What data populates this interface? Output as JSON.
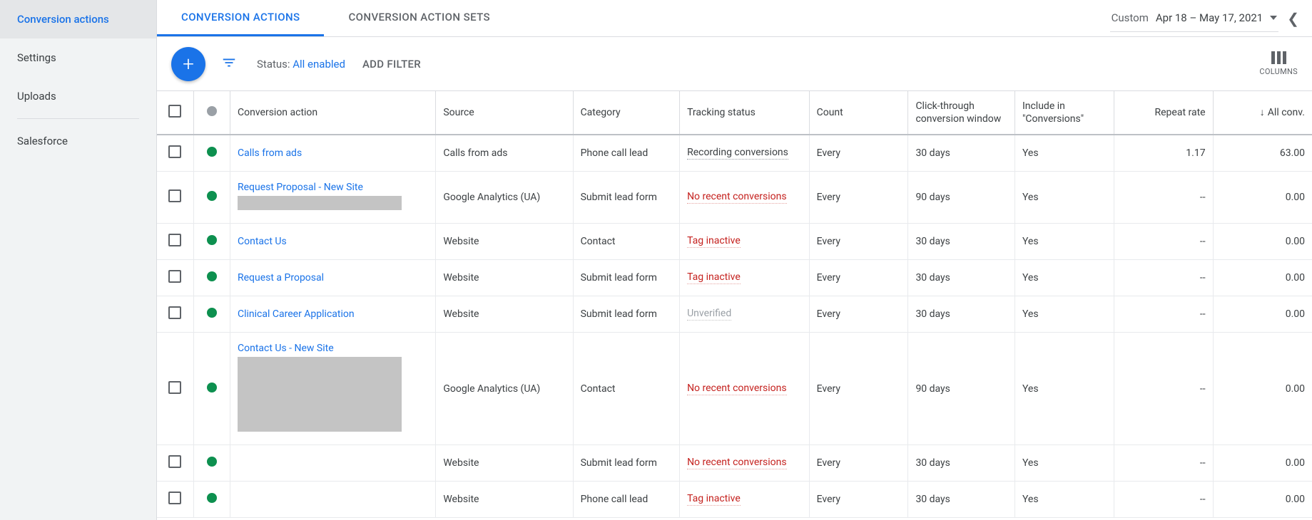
{
  "sidebar": {
    "items": [
      {
        "label": "Conversion actions",
        "active": true
      },
      {
        "label": "Settings",
        "active": false
      },
      {
        "label": "Uploads",
        "active": false
      },
      {
        "label": "Salesforce",
        "active": false
      }
    ]
  },
  "tabs": [
    {
      "label": "CONVERSION ACTIONS",
      "active": true
    },
    {
      "label": "CONVERSION ACTION SETS",
      "active": false
    }
  ],
  "datePicker": {
    "modeLabel": "Custom",
    "range": "Apr 18 – May 17, 2021"
  },
  "filterBar": {
    "statusPrefix": "Status: ",
    "statusValue": "All enabled",
    "addFilter": "ADD FILTER",
    "columnsLabel": "COLUMNS"
  },
  "table": {
    "headers": {
      "conversionAction": "Conversion action",
      "source": "Source",
      "category": "Category",
      "trackingStatus": "Tracking status",
      "count": "Count",
      "clickWindow": "Click-through conversion window",
      "include": "Include in \"Conversions\"",
      "repeatRate": "Repeat rate",
      "allConv": "All conv."
    },
    "rows": [
      {
        "status": "green",
        "name": "Calls from ads",
        "redacted": false,
        "source": "Calls from ads",
        "category": "Phone call lead",
        "tracking": "Recording conversions",
        "trackClass": "ok",
        "count": "Every",
        "window": "30 days",
        "include": "Yes",
        "repeat": "1.17",
        "allconv": "63.00"
      },
      {
        "status": "green",
        "name": "Request Proposal - New Site",
        "redacted": true,
        "source": "Google Analytics (UA)",
        "category": "Submit lead form",
        "tracking": "No recent conversions",
        "trackClass": "warn",
        "count": "Every",
        "window": "90 days",
        "include": "Yes",
        "repeat": "--",
        "allconv": "0.00"
      },
      {
        "status": "green",
        "name": "Contact Us",
        "redacted": false,
        "source": "Website",
        "category": "Contact",
        "tracking": "Tag inactive",
        "trackClass": "warn",
        "count": "Every",
        "window": "30 days",
        "include": "Yes",
        "repeat": "--",
        "allconv": "0.00"
      },
      {
        "status": "green",
        "name": "Request a Proposal",
        "redacted": false,
        "source": "Website",
        "category": "Submit lead form",
        "tracking": "Tag inactive",
        "trackClass": "warn",
        "count": "Every",
        "window": "30 days",
        "include": "Yes",
        "repeat": "--",
        "allconv": "0.00"
      },
      {
        "status": "green",
        "name": "Clinical Career Application",
        "redacted": false,
        "source": "Website",
        "category": "Submit lead form",
        "tracking": "Unverified",
        "trackClass": "muted",
        "count": "Every",
        "window": "30 days",
        "include": "Yes",
        "repeat": "--",
        "allconv": "0.00"
      },
      {
        "status": "green",
        "name": "Contact Us - New Site",
        "redacted": true,
        "redactedBig": true,
        "source": "Google Analytics (UA)",
        "category": "Contact",
        "tracking": "No recent conversions",
        "trackClass": "warn",
        "count": "Every",
        "window": "90 days",
        "include": "Yes",
        "repeat": "--",
        "allconv": "0.00"
      },
      {
        "status": "green",
        "name": "",
        "redacted": false,
        "hiddenName": true,
        "source": "Website",
        "category": "Submit lead form",
        "tracking": "No recent conversions",
        "trackClass": "warn",
        "count": "Every",
        "window": "30 days",
        "include": "Yes",
        "repeat": "--",
        "allconv": "0.00"
      },
      {
        "status": "green",
        "name": "",
        "redacted": false,
        "hiddenName": true,
        "source": "Website",
        "category": "Phone call lead",
        "tracking": "Tag inactive",
        "trackClass": "warn",
        "count": "Every",
        "window": "30 days",
        "include": "Yes",
        "repeat": "--",
        "allconv": "0.00"
      }
    ]
  }
}
